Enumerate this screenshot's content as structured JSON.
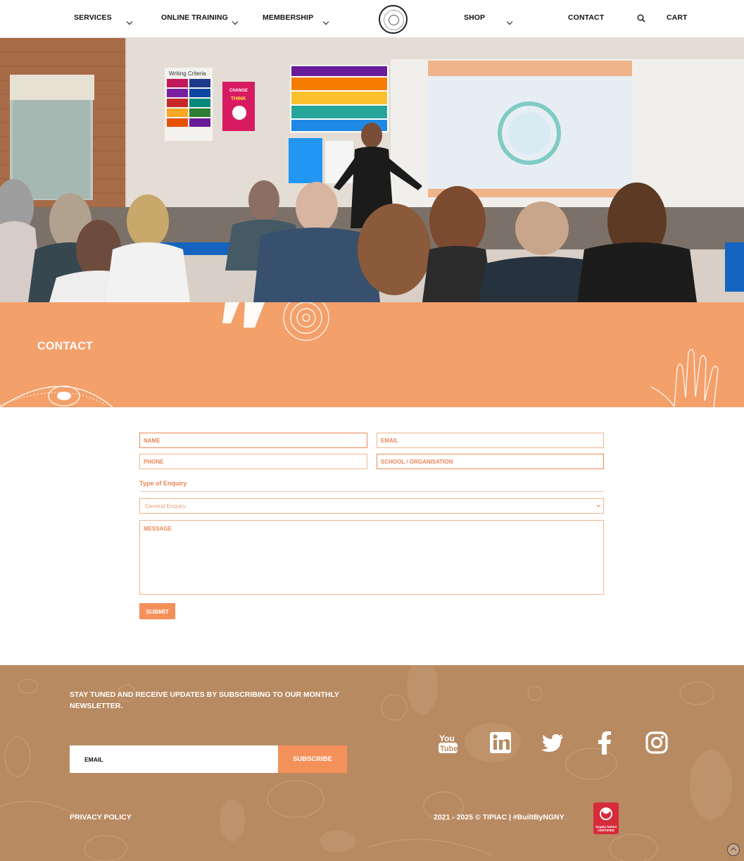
{
  "nav": {
    "services": "SERVICES",
    "online_training": "ONLINE TRAINING",
    "membership": "MEMBERSHIP",
    "shop": "SHOP",
    "contact": "CONTACT",
    "cart": "CART",
    "search_icon": "search-icon"
  },
  "hero": {
    "poster_writing": "Writing Criteria",
    "poster_change": "CHANGE",
    "poster_think": "THINK"
  },
  "contact": {
    "title": "CONTACT"
  },
  "form": {
    "name_placeholder": "NAME",
    "email_placeholder": "EMAIL",
    "phone_placeholder": "PHONE",
    "school_placeholder": "SCHOOL / ORGANISATION",
    "enquiry_label": "Type of Enquiry",
    "enquiry_selected": "General Enquiry",
    "message_placeholder": "MESSAGE",
    "submit_label": "SUBMIT"
  },
  "footer": {
    "newsletter_text": "STAY TUNED AND RECEIVE UPDATES BY SUBSCRIBING TO OUR MONTHLY NEWSLETTER.",
    "email_placeholder": "EMAIL",
    "subscribe_label": "SUBSCRIBE",
    "privacy_label": "PRIVACY POLICY",
    "copyright": "2021 - 2025 © TIPIAC | #BuiltByNGNY",
    "supply_badge_line1": "Supply Nation",
    "supply_badge_line2": "CERTIFIED",
    "social_icons": [
      "youtube-icon",
      "linkedin-icon",
      "twitter-icon",
      "facebook-icon",
      "instagram-icon"
    ]
  },
  "colors": {
    "accent_orange": "#f4a06a",
    "button_orange": "#f4905a",
    "footer_brown": "#b88a62",
    "badge_red": "#d62b3a"
  }
}
